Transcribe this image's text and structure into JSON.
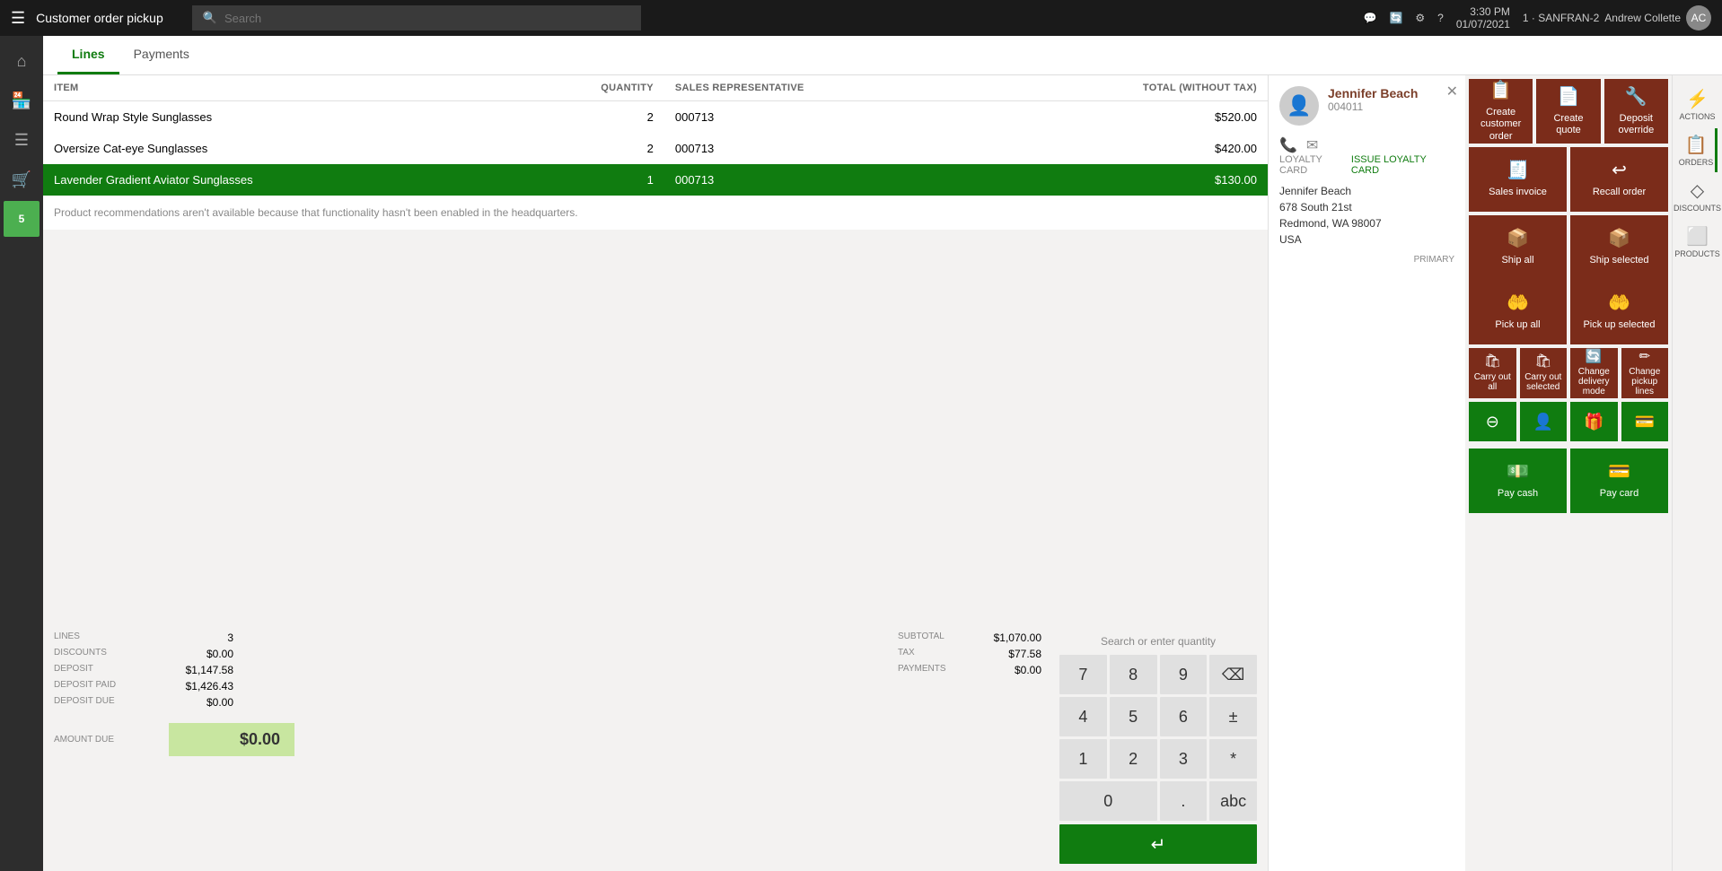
{
  "topbar": {
    "hamburger": "☰",
    "title": "Customer order pickup",
    "search_placeholder": "Search",
    "time": "3:30 PM",
    "date": "01/07/2021",
    "store": "1 · SANFRAN-2",
    "user": "Andrew Collette"
  },
  "tabs": [
    {
      "id": "lines",
      "label": "Lines",
      "active": true
    },
    {
      "id": "payments",
      "label": "Payments",
      "active": false
    }
  ],
  "table": {
    "headers": [
      "ITEM",
      "QUANTITY",
      "SALES REPRESENTATIVE",
      "TOTAL (WITHOUT TAX)"
    ],
    "rows": [
      {
        "item": "Round Wrap Style Sunglasses",
        "quantity": "2",
        "rep": "000713",
        "total": "$520.00",
        "selected": false
      },
      {
        "item": "Oversize Cat-eye Sunglasses",
        "quantity": "2",
        "rep": "000713",
        "total": "$420.00",
        "selected": false
      },
      {
        "item": "Lavender Gradient Aviator Sunglasses",
        "quantity": "1",
        "rep": "000713",
        "total": "$130.00",
        "selected": true
      }
    ]
  },
  "recommendation_msg": "Product recommendations aren't available because that functionality hasn't been enabled in the headquarters.",
  "numpad": {
    "search_label": "Search or enter quantity",
    "keys": [
      "7",
      "8",
      "9",
      "⌫",
      "4",
      "5",
      "6",
      "±",
      "1",
      "2",
      "3",
      "*",
      "0",
      "",
      ".",
      "abc"
    ],
    "enter_symbol": "↵"
  },
  "summary": {
    "lines_label": "LINES",
    "lines_value": "3",
    "subtotal_label": "SUBTOTAL",
    "subtotal_value": "$1,070.00",
    "discounts_label": "DISCOUNTS",
    "discounts_value": "$0.00",
    "tax_label": "TAX",
    "tax_value": "$77.58",
    "deposit_label": "DEPOSIT",
    "deposit_value": "$1,147.58",
    "payments_label": "PAYMENTS",
    "payments_value": "$0.00",
    "deposit_paid_label": "DEPOSIT PAID",
    "deposit_paid_value": "$1,426.43",
    "deposit_due_label": "DEPOSIT DUE",
    "deposit_due_value": "$0.00",
    "amount_due_label": "AMOUNT DUE",
    "amount_due_value": "$0.00"
  },
  "customer": {
    "name": "Jennifer Beach",
    "id": "004011",
    "address_line1": "Jennifer Beach",
    "address_line2": "678 South 21st",
    "address_line3": "Redmond, WA 98007",
    "address_line4": "USA",
    "loyalty_label": "LOYALTY CARD",
    "loyalty_action": "Issue loyalty card",
    "primary_label": "PRIMARY"
  },
  "action_buttons": {
    "row1": [
      {
        "id": "create-customer-order",
        "label": "Create customer order",
        "icon": "📋"
      },
      {
        "id": "create-quote",
        "label": "Create quote",
        "icon": "📄"
      },
      {
        "id": "deposit-override",
        "label": "Deposit override",
        "icon": "🔧"
      }
    ],
    "row2": [
      {
        "id": "sales-invoice",
        "label": "Sales invoice",
        "icon": "🧾"
      },
      {
        "id": "recall-order",
        "label": "Recall order",
        "icon": "↩"
      }
    ],
    "ship": [
      {
        "id": "ship-all",
        "label": "Ship all",
        "icon": "📦"
      },
      {
        "id": "ship-selected",
        "label": "Ship selected",
        "icon": "📦"
      }
    ],
    "pickup": [
      {
        "id": "pick-up-all",
        "label": "Pick up all",
        "icon": "🤲"
      },
      {
        "id": "pick-up-selected",
        "label": "Pick up selected",
        "icon": "🤲"
      }
    ],
    "carry": [
      {
        "id": "carry-out-all",
        "label": "Carry out all",
        "icon": "🛍"
      },
      {
        "id": "carry-out-selected",
        "label": "Carry out selected",
        "icon": "🛍"
      },
      {
        "id": "change-delivery-mode",
        "label": "Change delivery mode",
        "icon": "🔄"
      },
      {
        "id": "change-pickup-lines",
        "label": "Change pickup lines",
        "icon": "✏"
      }
    ],
    "icon_row": [
      {
        "id": "discount-icon",
        "icon": "⊖"
      },
      {
        "id": "customer-icon",
        "icon": "👤"
      },
      {
        "id": "gift-card-icon",
        "icon": "🎁"
      },
      {
        "id": "loyalty-icon",
        "icon": "💳"
      }
    ],
    "pay": [
      {
        "id": "pay-cash",
        "label": "Pay cash",
        "icon": "💵"
      },
      {
        "id": "pay-card",
        "label": "Pay card",
        "icon": "💳"
      }
    ]
  },
  "far_right": [
    {
      "id": "actions",
      "label": "ACTIONS",
      "icon": "⚡"
    },
    {
      "id": "orders",
      "label": "ORDERS",
      "icon": "📋",
      "active": true
    },
    {
      "id": "discounts",
      "label": "DISCOUNTS",
      "icon": "◇"
    },
    {
      "id": "products",
      "label": "PRODUCTS",
      "icon": "⬜"
    }
  ],
  "left_sidebar": [
    {
      "id": "home",
      "icon": "⌂"
    },
    {
      "id": "store",
      "icon": "🏪"
    },
    {
      "id": "menu",
      "icon": "☰"
    },
    {
      "id": "cart",
      "icon": "🛒",
      "active": true
    },
    {
      "id": "badge",
      "label": "5"
    }
  ]
}
